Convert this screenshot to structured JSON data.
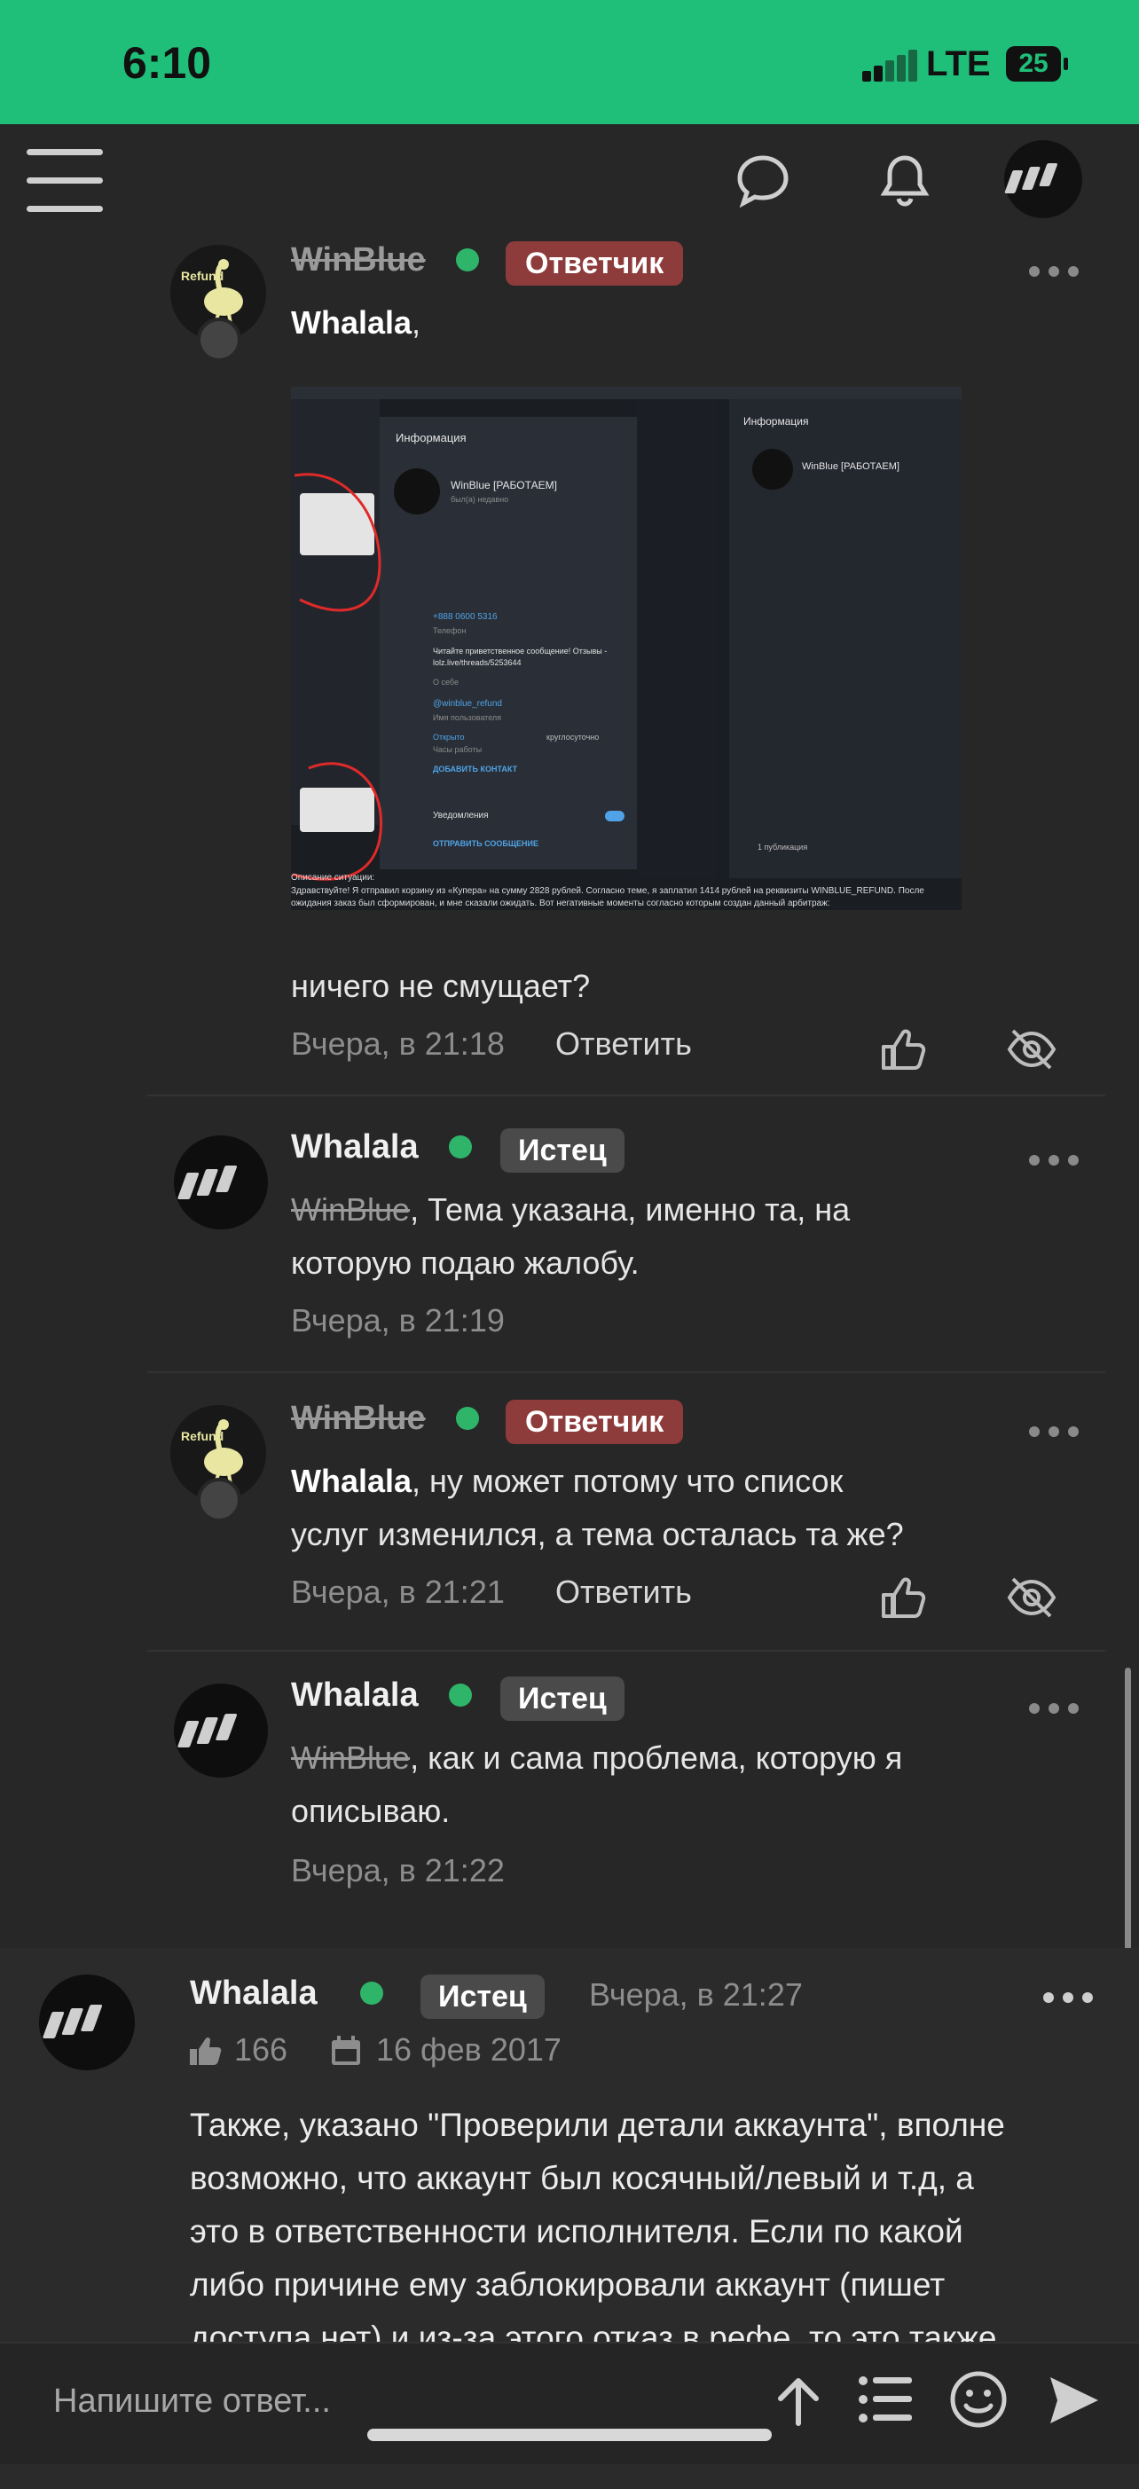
{
  "status_bar": {
    "time": "6:10",
    "network": "LTE",
    "battery": "25"
  },
  "header": {
    "menu_icon": "menu-icon",
    "chat_icon": "chat-icon",
    "bell_icon": "bell-icon"
  },
  "comments": [
    {
      "author": "WinBlue",
      "author_strike": true,
      "role": "Ответчик",
      "mention": "Whalala",
      "text_after": ",",
      "image_caption_title": "Описание ситуации:",
      "image_caption_body": "Здравствуйте! Я отправил корзину из «Купера» на сумму 2828 рублей. Согласно теме, я заплатил 1414 рублей на реквизиты WINBLUE_REFUND. После ожидания заказ был сформирован, и мне сказали ожидать. Вот негативные моменты согласно которым создан данный арбитраж:",
      "text_line2": "ничего не смущает?",
      "time": "Вчера, в 21:18",
      "reply": "Ответить"
    },
    {
      "author": "Whalala",
      "role": "Истец",
      "mention": "WinBlue",
      "text_1": ", Тема указана, именно та, на",
      "text_2": "которую подаю жалобу.",
      "time": "Вчера, в 21:19"
    },
    {
      "author": "WinBlue",
      "role": "Ответчик",
      "mention": "Whalala",
      "text_1": ", ну может потому что список",
      "text_2": "услуг изменился, а тема осталась та же?",
      "time": "Вчера, в 21:21",
      "reply": "Ответить"
    },
    {
      "author": "Whalala",
      "role": "Истец",
      "mention": "WinBlue",
      "text_1": ", как и сама проблема, которую я",
      "text_2": "описываю.",
      "time": "Вчера, в 21:22"
    }
  ],
  "screenshot_inner": {
    "panel_title": "Информация",
    "channel_name": "WinBlue [РАБОТАЕМ]",
    "channel_sub": "был(а) недавно",
    "phone": "+888 0600 5316",
    "phone_label": "Телефон",
    "notice": "Читайте приветственное сообщение! Отзывы - lolz.live/threads/5253644",
    "about": "О себе",
    "username": "@winblue_refund",
    "username_label": "Имя пользователя",
    "open": "Открыто",
    "hours": "круглосуточно",
    "hours_label": "Часы работы",
    "add_contact": "ДОБАВИТЬ КОНТАКТ",
    "notifications": "Уведомления",
    "send_message": "ОТПРАВИТЬ СООБЩЕНИЕ",
    "right_title": "Информация",
    "publications": "1 публикация"
  },
  "post": {
    "author": "Whalala",
    "role": "Истец",
    "time": "Вчера, в 21:27",
    "likes": "166",
    "date": "16 фев 2017",
    "lines": [
      "Также, указано \"Проверили детали аккаунта\", вполне",
      "возможно, что аккаунт был косячный/левый и т.д, а",
      "это в ответственности исполнителя. Если по какой",
      "либо причине ему заблокировали аккаунт (пишет",
      "доступа нет) и из-за этого отказ в рефе, то это также"
    ]
  },
  "composer": {
    "placeholder": "Напишите ответ..."
  },
  "colors": {
    "accent": "#1fbf7a",
    "respondent": "#8e3b3b",
    "plaintiff": "#4a4a4a",
    "online": "#2fb56a"
  }
}
